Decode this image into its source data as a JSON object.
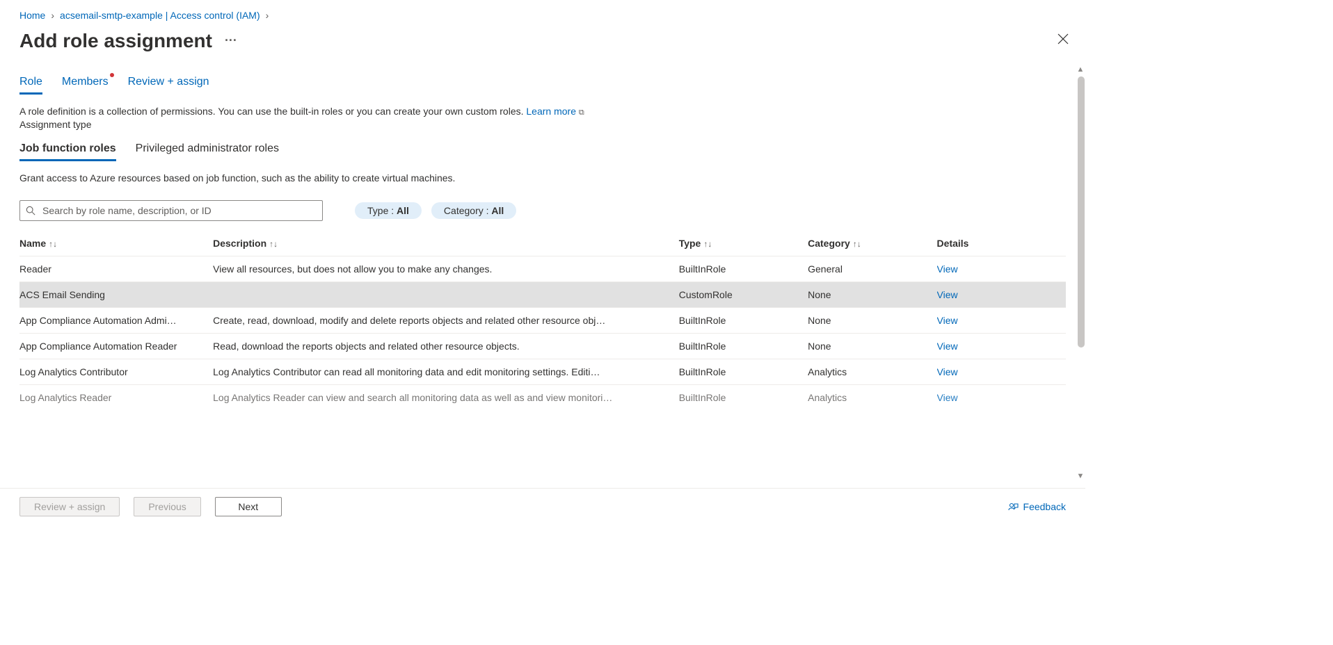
{
  "breadcrumb": {
    "home": "Home",
    "resource": "acsemail-smtp-example | Access control (IAM)"
  },
  "title": "Add role assignment",
  "tabs": {
    "role": "Role",
    "members": "Members",
    "review": "Review + assign"
  },
  "helper_text": "A role definition is a collection of permissions. You can use the built-in roles or you can create your own custom roles.",
  "learn_more": "Learn more",
  "assignment_type_label": "Assignment type",
  "subtabs": {
    "job": "Job function roles",
    "priv": "Privileged administrator roles"
  },
  "subhelper": "Grant access to Azure resources based on job function, such as the ability to create virtual machines.",
  "search_placeholder": "Search by role name, description, or ID",
  "filter_type": {
    "label": "Type : ",
    "value": "All"
  },
  "filter_category": {
    "label": "Category : ",
    "value": "All"
  },
  "columns": {
    "name": "Name",
    "description": "Description",
    "type": "Type",
    "category": "Category",
    "details": "Details"
  },
  "view_label": "View",
  "rows": [
    {
      "name": "Reader",
      "desc": "View all resources, but does not allow you to make any changes.",
      "type": "BuiltInRole",
      "cat": "General",
      "selected": false
    },
    {
      "name": "ACS Email Sending",
      "desc": "",
      "type": "CustomRole",
      "cat": "None",
      "selected": true
    },
    {
      "name": "App Compliance Automation Admi…",
      "desc": "Create, read, download, modify and delete reports objects and related other resource obj…",
      "type": "BuiltInRole",
      "cat": "None",
      "selected": false
    },
    {
      "name": "App Compliance Automation Reader",
      "desc": "Read, download the reports objects and related other resource objects.",
      "type": "BuiltInRole",
      "cat": "None",
      "selected": false
    },
    {
      "name": "Log Analytics Contributor",
      "desc": "Log Analytics Contributor can read all monitoring data and edit monitoring settings. Editi…",
      "type": "BuiltInRole",
      "cat": "Analytics",
      "selected": false
    },
    {
      "name": "Log Analytics Reader",
      "desc": "Log Analytics Reader can view and search all monitoring data as well as and view monitori…",
      "type": "BuiltInRole",
      "cat": "Analytics",
      "selected": false
    }
  ],
  "footer": {
    "review": "Review + assign",
    "previous": "Previous",
    "next": "Next",
    "feedback": "Feedback"
  }
}
